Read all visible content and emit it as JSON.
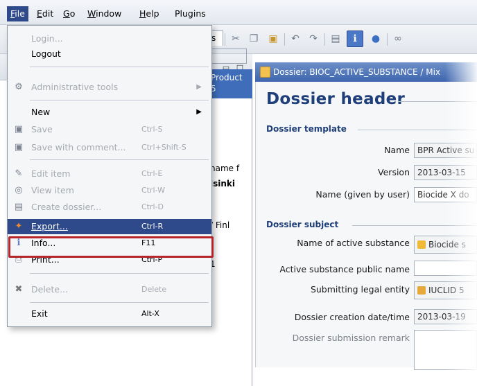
{
  "menubar": {
    "items": [
      {
        "label": "File",
        "mn": "F",
        "rest": "ile"
      },
      {
        "label": "Edit",
        "mn": "E",
        "rest": "dit"
      },
      {
        "label": "Go",
        "mn": "G",
        "rest": "o"
      },
      {
        "label": "Window",
        "mn": "W",
        "rest": "indow"
      },
      {
        "label": "Help",
        "mn": "H",
        "rest": "elp"
      },
      {
        "label": "Plugins"
      }
    ]
  },
  "toolbar": {
    "icons": [
      "refresh-icon",
      "cut-icon",
      "copy-icon",
      "paste-icon",
      "undo-icon",
      "redo-icon",
      "document-icon",
      "info-icon",
      "help-icon",
      "link-icon"
    ]
  },
  "left_pane": {
    "tab_label": "s",
    "header_line1": "Product",
    "header_line2": "5",
    "col_text": "name f",
    "row_text": "lsinki",
    "row2_text": "/ Finl",
    "col2_text": "t",
    "row3_text": "1"
  },
  "file_menu": {
    "items": [
      {
        "label": "Login...",
        "shortcut": "",
        "disabled": true
      },
      {
        "label": "Logout",
        "shortcut": "",
        "disabled": false
      },
      {
        "label": "Administrative tools",
        "shortcut": "",
        "disabled": true,
        "submenu": true,
        "icon": "admin-tools-icon"
      },
      {
        "label": "New",
        "shortcut": "",
        "disabled": false,
        "submenu": true
      },
      {
        "label": "Save",
        "shortcut": "Ctrl-S",
        "disabled": true,
        "icon": "save-icon"
      },
      {
        "label": "Save with comment...",
        "shortcut": "Ctrl+Shift-S",
        "disabled": true,
        "icon": "save-comment-icon"
      },
      {
        "label": "Edit item",
        "shortcut": "Ctrl-E",
        "disabled": true,
        "icon": "edit-icon"
      },
      {
        "label": "View item",
        "shortcut": "Ctrl-W",
        "disabled": true,
        "icon": "view-icon"
      },
      {
        "label": "Create dossier...",
        "shortcut": "Ctrl-D",
        "disabled": true,
        "icon": "create-dossier-icon"
      },
      {
        "label": "Export...",
        "shortcut": "Ctrl-R",
        "disabled": false,
        "selected": true,
        "icon": "export-icon"
      },
      {
        "label": "Info...",
        "shortcut": "F11",
        "disabled": false,
        "icon": "info-icon"
      },
      {
        "label": "Print...",
        "shortcut": "Ctrl-P",
        "disabled": false,
        "icon": "print-icon"
      },
      {
        "label": "Delete...",
        "shortcut": "Delete",
        "disabled": true,
        "icon": "delete-icon"
      },
      {
        "label": "Exit",
        "shortcut": "Alt-X",
        "disabled": false
      }
    ]
  },
  "dossier": {
    "tab_title": "Dossier: BIOC_ACTIVE_SUBSTANCE / Mix",
    "header_title": "Dossier header",
    "template_section": "Dossier template",
    "subject_section": "Dossier subject",
    "fields": [
      {
        "label": "Name",
        "value": "BPR Active su"
      },
      {
        "label": "Version",
        "value": "2013-03-15"
      },
      {
        "label": "Name (given by user)",
        "value": "Biocide X do"
      }
    ],
    "subject_fields": [
      {
        "label": "Name of active substance",
        "value": "Biocide s"
      },
      {
        "label": "Active substance public name",
        "value": ""
      },
      {
        "label": "Submitting legal entity",
        "value": "IUCLID 5"
      },
      {
        "label": "Dossier creation date/time",
        "value": "2013-03-19"
      },
      {
        "label": "Dossier submission remark",
        "value": ""
      }
    ]
  },
  "colors": {
    "menu_selection": "#2f4a8a",
    "highlight_box": "#b5262c",
    "dossier_title": "#1f3f7a"
  }
}
